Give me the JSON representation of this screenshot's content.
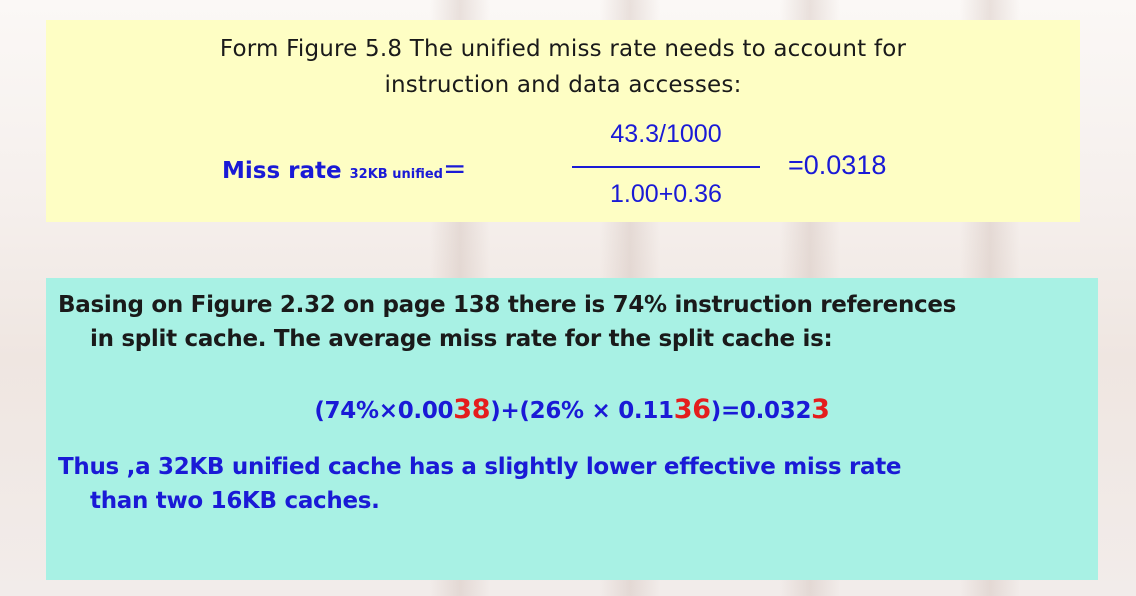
{
  "top": {
    "line1": "Form Figure 5.8 The unified miss rate needs to account for",
    "line2": "instruction and data accesses:",
    "formula": {
      "label": "Miss rate",
      "subscript": "32KB unified",
      "equals": "=",
      "numerator": "43.3/1000",
      "denominator": "1.00+0.36",
      "result": "=0.0318"
    }
  },
  "bottom": {
    "line1": "Basing on Figure 2.32 on page 138 there is 74% instruction references",
    "line2": "in split cache. The average miss rate for the split cache is:",
    "calc": {
      "p1": "(74%",
      "times1": "×",
      "p2": "0.00",
      "p2_red": "38",
      "p3": ")+(26% ",
      "times2": "×",
      "p4": " 0.11",
      "p4_red": "36",
      "p5": ")=0.032",
      "p5_red": "3"
    },
    "line4": "Thus ,a 32KB unified cache has a slightly lower effective miss rate",
    "line5": "than two 16KB caches."
  },
  "colors": {
    "top_box": "#fefec4",
    "bottom_box": "#a8f1e4",
    "blue_text": "#1a1ad6",
    "red_text": "#e41d1d"
  }
}
